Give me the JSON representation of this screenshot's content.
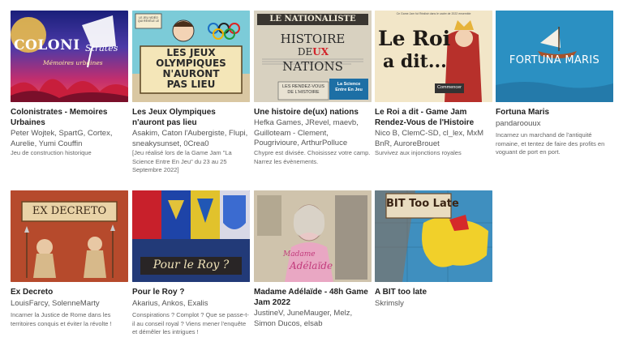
{
  "games": [
    {
      "title": "Colonistrates - Memoires Urbaines",
      "authors": "Peter Wojtek, SpartG, Cortex, Aurelie, Yumi Couffin",
      "description": "Jeu de construction historique",
      "art": {
        "line1": "COLONI",
        "line2": "Stra",
        "line3": "tes",
        "line4": "Mémoires urbaines"
      }
    },
    {
      "title": "Les Jeux Olympiques n'auront pas lieu",
      "authors": "Asakim, Caton l'Aubergiste, Flupi, sneakysunset, 0Crea0",
      "description": "[Jeu réalisé lors de la Game Jam \"La Science Entre En Jeu\" du 23 au 25 Septembre 2022]",
      "art": {
        "line1": "LES JEUX",
        "line2": "OLYMPIQUES",
        "line3": "N'AURONT",
        "line4": "PAS LIEU",
        "banner": "LE JEU VIDÉO QUI RÉVÈLE LE"
      }
    },
    {
      "title": "Une histoire de(ux) nations",
      "authors": "Hefka Games, JRevel, maevb, Guilloteam - Clement, Pougrivioure, ArthurPolluce",
      "description": "Chypre est divisée. Choisissez votre camp. Narrez les évènements.",
      "art": {
        "line1": "LE NATIONALISTE",
        "line2": "HISTOIRE",
        "line3": "DE",
        "line4": "UX",
        "line5": "NATIONS",
        "line6": "LES RENDEZ-VOUS",
        "line7": "DE L'HISTOIRE",
        "badge1": "La Science",
        "badge2": "Entre En Jeu"
      }
    },
    {
      "title": "Le Roi a dit - Game Jam Rendez-Vous de l'Histoire",
      "authors": "Nico B, ClemC-SD, cl_lex, MxM BnR, AuroreBrouet",
      "description": "Survivez aux injonctions royales",
      "art": {
        "line1": "Le Roi",
        "line2": "a dit...",
        "header": "Ce Game Jam fut Réalisé dans le cadre de 2022 ensemble",
        "button": "Commencer"
      }
    },
    {
      "title": "Fortuna Maris",
      "authors": "pandaroouux",
      "description": "Incarnez un marchand de l'antiquité romaine, et tentez de faire des profits en voguant de port en port.",
      "art": {
        "line1": "FORTUNA MARIS"
      }
    },
    {
      "title": "Ex Decreto",
      "authors": "LouisFarcy, SolenneMarty",
      "description": "Incarner la Justice de Rome dans les territoires conquis et éviter la révolte !",
      "art": {
        "line1": "EX DECRETO"
      }
    },
    {
      "title": "Pour le Roy ?",
      "authors": "Akarius, Ankos, Exalis",
      "description": "Conspirations ? Complot ? Que se passe-t-il au conseil royal ? Viens mener l'enquête et démêler les intrigues !",
      "art": {
        "line1": "Pour le Roy ?"
      }
    },
    {
      "title": "Madame Adélaïde - 48h Game Jam 2022",
      "authors": "JustineV, JuneMauger, Melz, Simon Ducos, elsab",
      "description": "",
      "art": {
        "line1": "Madame",
        "line2": "Adélaïde"
      }
    },
    {
      "title": "A BIT too late",
      "authors": "Skrimsly",
      "description": "",
      "art": {
        "line1": "BIT Too Late"
      }
    }
  ],
  "colors": {
    "title": "#222222",
    "authors": "#555555",
    "description": "#666666"
  }
}
